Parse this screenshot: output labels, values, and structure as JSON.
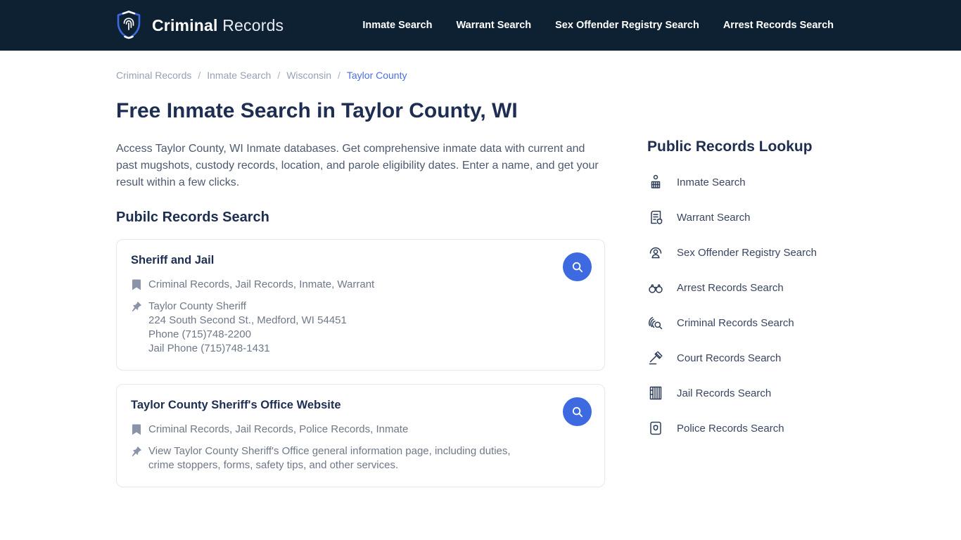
{
  "brand": {
    "name_bold": "Criminal",
    "name_regular": "Records"
  },
  "nav": {
    "items": [
      {
        "label": "Inmate Search"
      },
      {
        "label": "Warrant Search"
      },
      {
        "label": "Sex Offender Registry Search"
      },
      {
        "label": "Arrest Records Search"
      }
    ]
  },
  "breadcrumb": {
    "separator": "/",
    "items": [
      {
        "label": "Criminal Records"
      },
      {
        "label": "Inmate Search"
      },
      {
        "label": "Wisconsin"
      },
      {
        "label": "Taylor County"
      }
    ]
  },
  "page": {
    "title": "Free Inmate Search in Taylor County, WI",
    "intro": "Access Taylor County, WI Inmate databases. Get comprehensive inmate data with current and past mugshots, custody records, location, and parole eligibility dates. Enter a name, and get your result within a few clicks.",
    "section_heading": "Pubilc Records Search"
  },
  "cards": [
    {
      "title": "Sheriff and Jail",
      "categories": "Criminal Records, Jail Records, Inmate, Warrant",
      "details": [
        "Taylor County Sheriff",
        "224 South Second St., Medford, WI 54451",
        "Phone (715)748-2200",
        "Jail Phone (715)748-1431"
      ]
    },
    {
      "title": "Taylor County Sheriff's Office Website",
      "categories": "Criminal Records, Jail Records, Police Records, Inmate",
      "details": [
        "View Taylor County Sheriff's Office general information page, including duties, crime stoppers, forms, safety tips, and other services."
      ]
    }
  ],
  "sidebar": {
    "heading": "Public Records Lookup",
    "items": [
      {
        "label": "Inmate Search",
        "icon": "inmate-search-icon"
      },
      {
        "label": "Warrant Search",
        "icon": "warrant-search-icon"
      },
      {
        "label": "Sex Offender Registry Search",
        "icon": "sex-offender-registry-icon"
      },
      {
        "label": "Arrest Records Search",
        "icon": "handcuffs-icon"
      },
      {
        "label": "Criminal Records Search",
        "icon": "fingerprint-search-icon"
      },
      {
        "label": "Court Records Search",
        "icon": "gavel-icon"
      },
      {
        "label": "Jail Records Search",
        "icon": "jail-bars-icon"
      },
      {
        "label": "Police Records Search",
        "icon": "police-badge-icon"
      }
    ]
  },
  "colors": {
    "navbar_bg": "#0e2133",
    "accent_blue": "#3d6ae1",
    "breadcrumb_active": "#4c6fe0",
    "heading_navy": "#1d2e52",
    "body_text": "#4d5a70",
    "muted_text": "#6f7888"
  }
}
